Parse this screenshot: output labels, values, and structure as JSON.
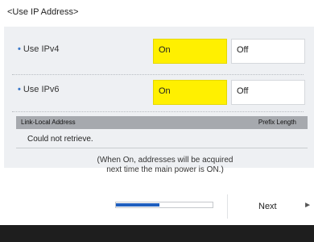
{
  "screen": {
    "title": "<Use IP Address>"
  },
  "settings": {
    "ipv4": {
      "label": "Use IPv4",
      "on_label": "On",
      "off_label": "Off",
      "selected": "On"
    },
    "ipv6": {
      "label": "Use IPv6",
      "on_label": "On",
      "off_label": "Off",
      "selected": "On"
    }
  },
  "table": {
    "headers": [
      "Link-Local Address",
      "Prefix Length"
    ],
    "value": "Could not retrieve."
  },
  "note": {
    "line1": "(When On, addresses will be acquired",
    "line2": "next time the main power is ON.)"
  },
  "footer": {
    "progress": 0.45,
    "next_label": "Next",
    "next_arrow": "►"
  },
  "colors": {
    "selected": "#fff000",
    "accent": "#3a78c9",
    "progress": "#1f5fbf",
    "bottom_bar": "#1e1e1e"
  }
}
